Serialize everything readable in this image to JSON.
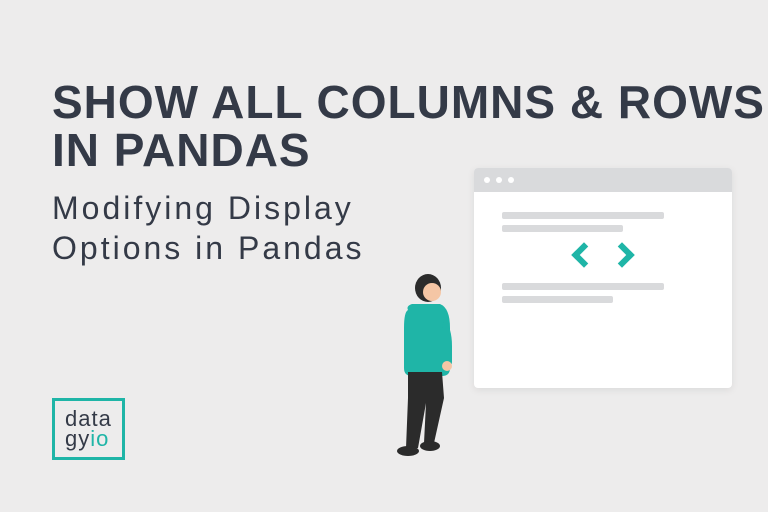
{
  "title_line1": "SHOW ALL COLUMNS & ROWS",
  "title_line2": "IN PANDAS",
  "subtitle_line1": "Modifying Display",
  "subtitle_line2": "Options in Pandas",
  "logo": {
    "line1": "data",
    "line2_prefix": "gy",
    "line2_suffix": "io"
  },
  "colors": {
    "accent": "#1fb5a7",
    "dark": "#343a47",
    "bg": "#edecec"
  }
}
